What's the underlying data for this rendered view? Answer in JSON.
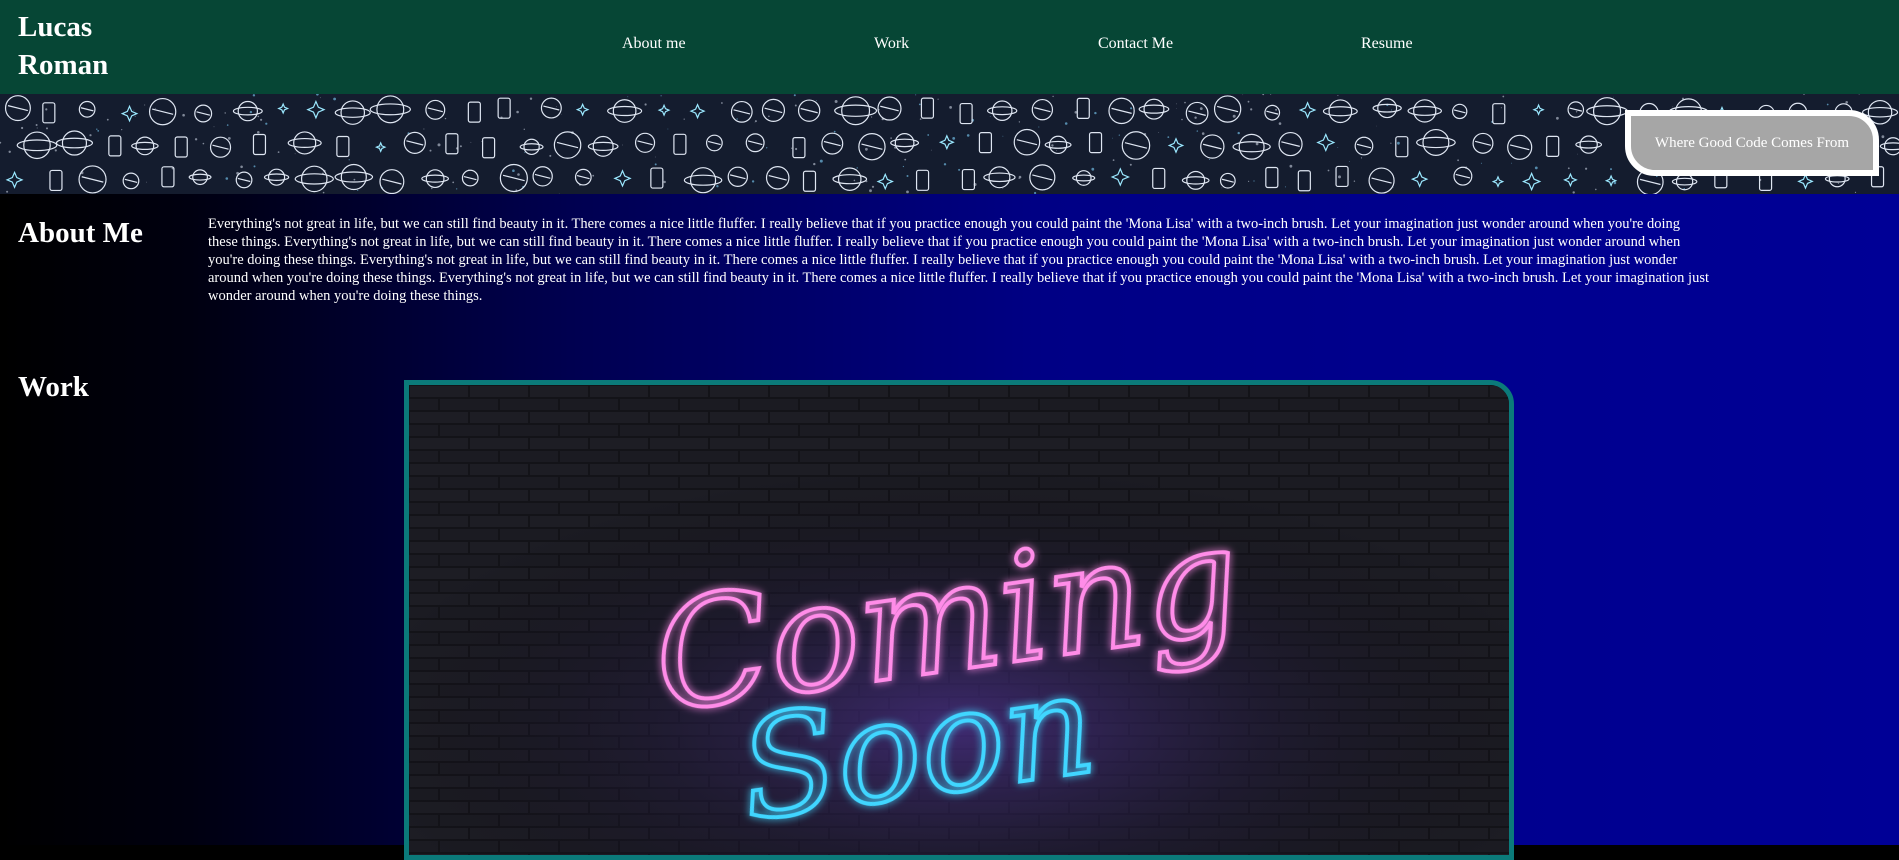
{
  "header": {
    "brand_line1": "Lucas",
    "brand_line2": "Roman",
    "nav": [
      {
        "label": "About me"
      },
      {
        "label": "Work"
      },
      {
        "label": "Contact Me"
      },
      {
        "label": "Resume"
      }
    ]
  },
  "banner": {
    "tagline": "Where Good Code Comes From"
  },
  "about": {
    "title": "About Me",
    "text": "Everything's not great in life, but we can still find beauty in it. There comes a nice little fluffer. I really believe that if you practice enough you could paint the 'Mona Lisa' with a two-inch brush. Let your imagination just wonder around when you're doing these things. Everything's not great in life, but we can still find beauty in it. There comes a nice little fluffer. I really believe that if you practice enough you could paint the 'Mona Lisa' with a two-inch brush. Let your imagination just wonder around when you're doing these things. Everything's not great in life, but we can still find beauty in it. There comes a nice little fluffer. I really believe that if you practice enough you could paint the 'Mona Lisa' with a two-inch brush. Let your imagination just wonder around when you're doing these things. Everything's not great in life, but we can still find beauty in it. There comes a nice little fluffer. I really believe that if you practice enough you could paint the 'Mona Lisa' with a two-inch brush. Let your imagination just wonder around when you're doing these things."
  },
  "work": {
    "title": "Work",
    "image_line1": "Coming",
    "image_line2": "Soon"
  },
  "colors": {
    "header_bg": "#064635",
    "gradient_end": "#000096",
    "card_border": "#0b7a7a",
    "neon_pink": "#ff8ce8",
    "neon_blue": "#3fd6ff"
  }
}
